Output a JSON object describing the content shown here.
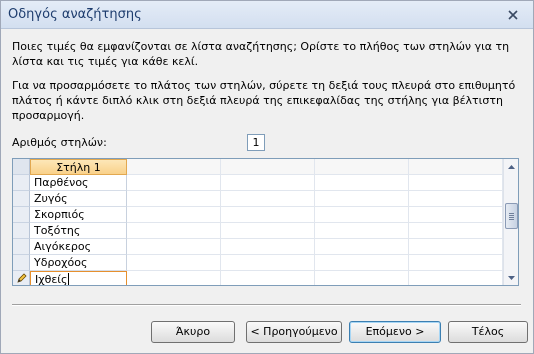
{
  "window": {
    "title": "Οδηγός αναζήτησης"
  },
  "instructions": {
    "p1": "Ποιες τιμές θα εμφανίζονται σε λίστα αναζήτησης; Ορίστε το πλήθος των στηλών για τη λίστα και τις τιμές για κάθε κελί.",
    "p2": "Για να προσαρμόσετε το πλάτος των στηλών, σύρετε τη δεξιά τους πλευρά στο επιθυμητό πλάτος ή κάντε διπλό κλικ στη δεξιά πλευρά της επικεφαλίδας της στήλης για βέλτιστη προσαρμογή."
  },
  "columns": {
    "label": "Αριθμός στηλών:",
    "value": "1"
  },
  "grid": {
    "header": "Στήλη 1",
    "rows": [
      "Παρθένος",
      "Ζυγός",
      "Σκορπιός",
      "Τοξότης",
      "Αιγόκερος",
      "Υδροχόος"
    ],
    "active_value": "Ιχθείς",
    "new_row_marker": "*"
  },
  "buttons": {
    "cancel": "Άκυρο",
    "back": "< Προηγούμενο",
    "next": "Επόμενο >",
    "finish": "Τέλος"
  }
}
